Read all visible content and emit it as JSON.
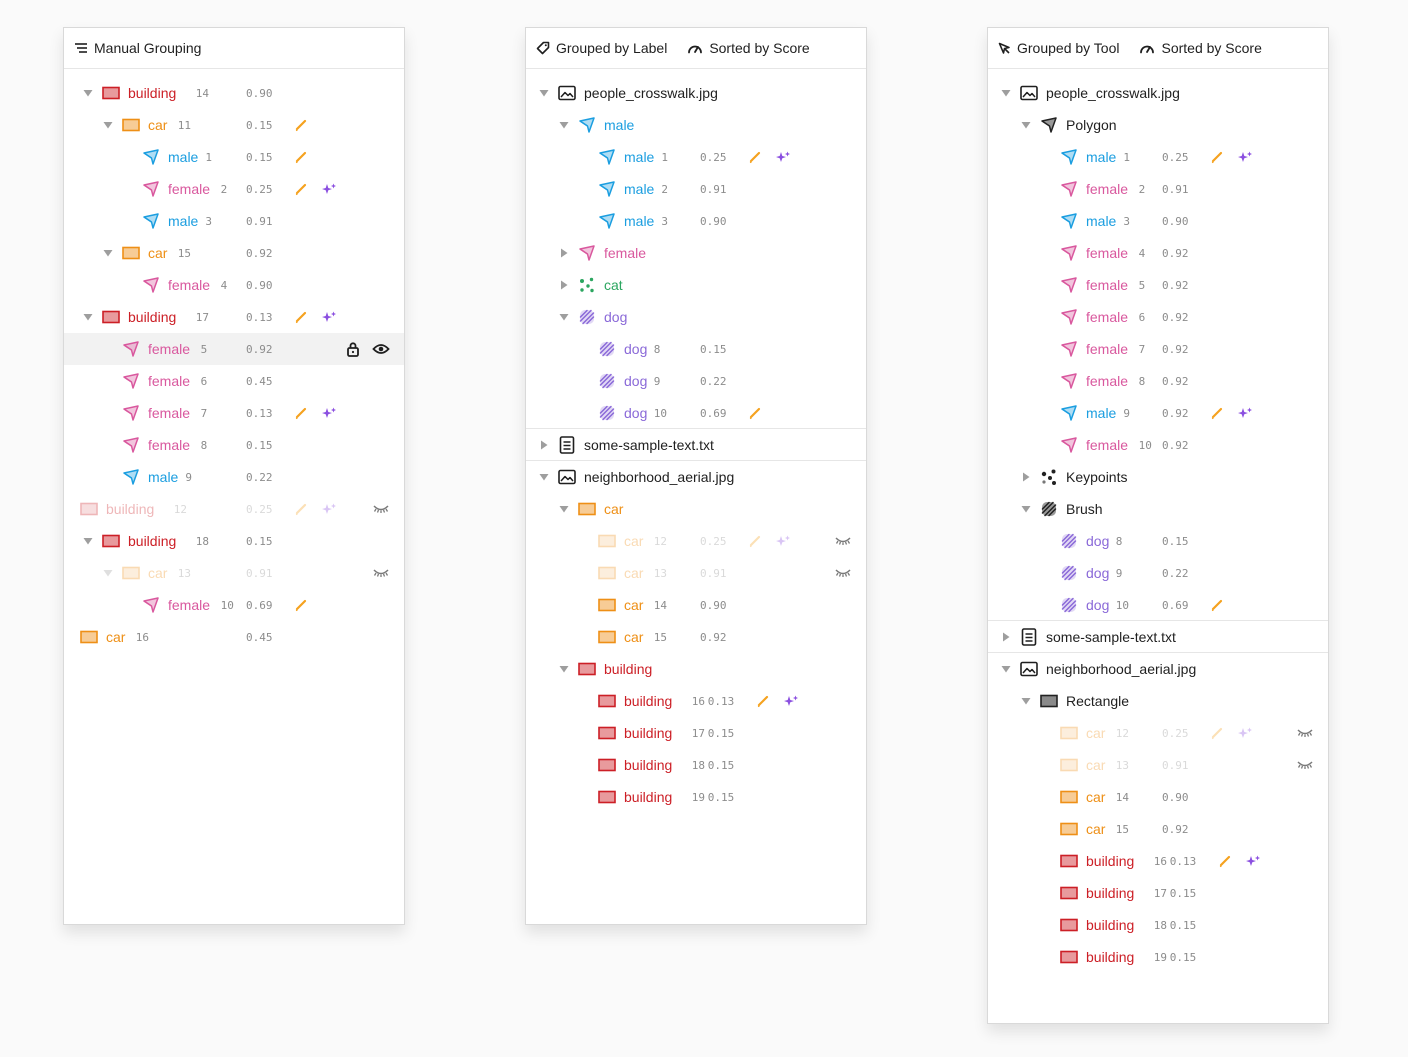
{
  "colors": {
    "building": "#cc1f26",
    "car": "#ee8f16",
    "male": "#1b9ee0",
    "female": "#d9589e",
    "dog": "#8a69d8",
    "cat": "#2ca660",
    "edit": "#f5a21f",
    "sparkle": "#8b4fe0"
  },
  "panels": [
    {
      "header": [
        {
          "icon": "list-icon",
          "label": "Manual Grouping"
        }
      ],
      "rows": [
        {
          "depth": 0,
          "caret": "down",
          "type": "ann",
          "cls": "building",
          "label": "building",
          "num": "14",
          "score": "0.90",
          "edit": false,
          "ai": false
        },
        {
          "depth": 1,
          "caret": "down",
          "type": "ann",
          "cls": "car",
          "label": "car",
          "num": "11",
          "score": "0.15",
          "edit": true,
          "ai": false
        },
        {
          "depth": 2,
          "caret": "",
          "type": "ann",
          "cls": "male",
          "label": "male",
          "num": "1",
          "score": "0.15",
          "edit": true,
          "ai": false
        },
        {
          "depth": 2,
          "caret": "",
          "type": "ann",
          "cls": "female",
          "label": "female",
          "num": "2",
          "score": "0.25",
          "edit": true,
          "ai": true
        },
        {
          "depth": 2,
          "caret": "",
          "type": "ann",
          "cls": "male",
          "label": "male",
          "num": "3",
          "score": "0.91",
          "edit": false,
          "ai": false
        },
        {
          "depth": 1,
          "caret": "down",
          "type": "ann",
          "cls": "car",
          "label": "car",
          "num": "15",
          "score": "0.92",
          "edit": false,
          "ai": false
        },
        {
          "depth": 2,
          "caret": "",
          "type": "ann",
          "cls": "female",
          "label": "female",
          "num": "4",
          "score": "0.90",
          "edit": false,
          "ai": false
        },
        {
          "depth": 0,
          "caret": "down",
          "type": "ann",
          "cls": "building",
          "label": "building",
          "num": "17",
          "score": "0.13",
          "edit": true,
          "ai": true
        },
        {
          "depth": 1,
          "caret": "",
          "type": "ann",
          "cls": "female",
          "label": "female",
          "num": "5",
          "score": "0.92",
          "edit": false,
          "ai": false,
          "selected": true,
          "lock": true,
          "eye": true
        },
        {
          "depth": 1,
          "caret": "",
          "type": "ann",
          "cls": "female",
          "label": "female",
          "num": "6",
          "score": "0.45",
          "edit": false,
          "ai": false
        },
        {
          "depth": 1,
          "caret": "",
          "type": "ann",
          "cls": "female",
          "label": "female",
          "num": "7",
          "score": "0.13",
          "edit": true,
          "ai": true
        },
        {
          "depth": 1,
          "caret": "",
          "type": "ann",
          "cls": "female",
          "label": "female",
          "num": "8",
          "score": "0.15",
          "edit": false,
          "ai": false
        },
        {
          "depth": 1,
          "caret": "",
          "type": "ann",
          "cls": "male",
          "label": "male",
          "num": "9",
          "score": "0.22",
          "edit": false,
          "ai": false
        },
        {
          "depth": -1,
          "caret": "",
          "type": "ann",
          "cls": "building",
          "label": "building",
          "num": "12",
          "score": "0.25",
          "edit": true,
          "ai": true,
          "hidden": true
        },
        {
          "depth": 0,
          "caret": "down",
          "type": "ann",
          "cls": "building",
          "label": "building",
          "num": "18",
          "score": "0.15",
          "edit": false,
          "ai": false
        },
        {
          "depth": 1,
          "caret": "down",
          "type": "ann",
          "cls": "car",
          "label": "car",
          "num": "13",
          "score": "0.91",
          "edit": false,
          "ai": false,
          "hidden": true
        },
        {
          "depth": 2,
          "caret": "",
          "type": "ann",
          "cls": "female",
          "label": "female",
          "num": "10",
          "score": "0.69",
          "edit": true,
          "ai": false
        },
        {
          "depth": -1,
          "caret": "",
          "type": "ann",
          "cls": "car",
          "label": "car",
          "num": "16",
          "score": "0.45",
          "edit": false,
          "ai": false
        }
      ]
    },
    {
      "header": [
        {
          "icon": "tag-icon",
          "label": "Grouped by Label"
        },
        {
          "icon": "gauge-icon",
          "label": "Sorted by Score"
        }
      ],
      "rows": [
        {
          "depth": 0,
          "caret": "down",
          "type": "file",
          "fileIcon": "image",
          "label": "people_crosswalk.jpg"
        },
        {
          "depth": 1,
          "caret": "down",
          "type": "group",
          "cls": "male",
          "label": "male"
        },
        {
          "depth": 2,
          "caret": "",
          "type": "ann",
          "cls": "male",
          "label": "male",
          "num": "1",
          "score": "0.25",
          "edit": true,
          "ai": true
        },
        {
          "depth": 2,
          "caret": "",
          "type": "ann",
          "cls": "male",
          "label": "male",
          "num": "2",
          "score": "0.91",
          "edit": false,
          "ai": false
        },
        {
          "depth": 2,
          "caret": "",
          "type": "ann",
          "cls": "male",
          "label": "male",
          "num": "3",
          "score": "0.90",
          "edit": false,
          "ai": false
        },
        {
          "depth": 1,
          "caret": "right",
          "type": "group",
          "cls": "female",
          "label": "female"
        },
        {
          "depth": 1,
          "caret": "right",
          "type": "group",
          "cls": "cat",
          "label": "cat"
        },
        {
          "depth": 1,
          "caret": "down",
          "type": "group",
          "cls": "dog",
          "label": "dog"
        },
        {
          "depth": 2,
          "caret": "",
          "type": "ann",
          "cls": "dog",
          "label": "dog",
          "num": "8",
          "score": "0.15",
          "edit": false,
          "ai": false
        },
        {
          "depth": 2,
          "caret": "",
          "type": "ann",
          "cls": "dog",
          "label": "dog",
          "num": "9",
          "score": "0.22",
          "edit": false,
          "ai": false
        },
        {
          "depth": 2,
          "caret": "",
          "type": "ann",
          "cls": "dog",
          "label": "dog",
          "num": "10",
          "score": "0.69",
          "edit": true,
          "ai": false
        },
        {
          "depth": 0,
          "caret": "right",
          "type": "file",
          "fileIcon": "text",
          "label": "some-sample-text.txt",
          "sep": true
        },
        {
          "depth": 0,
          "caret": "down",
          "type": "file",
          "fileIcon": "image",
          "label": "neighborhood_aerial.jpg",
          "sep": true
        },
        {
          "depth": 1,
          "caret": "down",
          "type": "group",
          "cls": "car",
          "label": "car"
        },
        {
          "depth": 2,
          "caret": "",
          "type": "ann",
          "cls": "car",
          "label": "car",
          "num": "12",
          "score": "0.25",
          "edit": true,
          "ai": true,
          "hidden": true
        },
        {
          "depth": 2,
          "caret": "",
          "type": "ann",
          "cls": "car",
          "label": "car",
          "num": "13",
          "score": "0.91",
          "edit": false,
          "ai": false,
          "hidden": true
        },
        {
          "depth": 2,
          "caret": "",
          "type": "ann",
          "cls": "car",
          "label": "car",
          "num": "14",
          "score": "0.90",
          "edit": false,
          "ai": false
        },
        {
          "depth": 2,
          "caret": "",
          "type": "ann",
          "cls": "car",
          "label": "car",
          "num": "15",
          "score": "0.92",
          "edit": false,
          "ai": false
        },
        {
          "depth": 1,
          "caret": "down",
          "type": "group",
          "cls": "building",
          "label": "building"
        },
        {
          "depth": 2,
          "caret": "",
          "type": "ann",
          "cls": "building",
          "label": "building",
          "num": "16",
          "score": "0.13",
          "edit": true,
          "ai": true
        },
        {
          "depth": 2,
          "caret": "",
          "type": "ann",
          "cls": "building",
          "label": "building",
          "num": "17",
          "score": "0.15",
          "edit": false,
          "ai": false
        },
        {
          "depth": 2,
          "caret": "",
          "type": "ann",
          "cls": "building",
          "label": "building",
          "num": "18",
          "score": "0.15",
          "edit": false,
          "ai": false
        },
        {
          "depth": 2,
          "caret": "",
          "type": "ann",
          "cls": "building",
          "label": "building",
          "num": "19",
          "score": "0.15",
          "edit": false,
          "ai": false
        }
      ]
    },
    {
      "header": [
        {
          "icon": "cursor-icon",
          "label": "Grouped by Tool"
        },
        {
          "icon": "gauge-icon",
          "label": "Sorted by Score"
        }
      ],
      "rows": [
        {
          "depth": 0,
          "caret": "down",
          "type": "file",
          "fileIcon": "image",
          "label": "people_crosswalk.jpg"
        },
        {
          "depth": 1,
          "caret": "down",
          "type": "tool",
          "tool": "polygon",
          "label": "Polygon"
        },
        {
          "depth": 2,
          "caret": "",
          "type": "ann",
          "cls": "male",
          "label": "male",
          "num": "1",
          "score": "0.25",
          "edit": true,
          "ai": true
        },
        {
          "depth": 2,
          "caret": "",
          "type": "ann",
          "cls": "female",
          "label": "female",
          "num": "2",
          "score": "0.91",
          "edit": false,
          "ai": false
        },
        {
          "depth": 2,
          "caret": "",
          "type": "ann",
          "cls": "male",
          "label": "male",
          "num": "3",
          "score": "0.90",
          "edit": false,
          "ai": false
        },
        {
          "depth": 2,
          "caret": "",
          "type": "ann",
          "cls": "female",
          "label": "female",
          "num": "4",
          "score": "0.92",
          "edit": false,
          "ai": false
        },
        {
          "depth": 2,
          "caret": "",
          "type": "ann",
          "cls": "female",
          "label": "female",
          "num": "5",
          "score": "0.92",
          "edit": false,
          "ai": false
        },
        {
          "depth": 2,
          "caret": "",
          "type": "ann",
          "cls": "female",
          "label": "female",
          "num": "6",
          "score": "0.92",
          "edit": false,
          "ai": false
        },
        {
          "depth": 2,
          "caret": "",
          "type": "ann",
          "cls": "female",
          "label": "female",
          "num": "7",
          "score": "0.92",
          "edit": false,
          "ai": false
        },
        {
          "depth": 2,
          "caret": "",
          "type": "ann",
          "cls": "female",
          "label": "female",
          "num": "8",
          "score": "0.92",
          "edit": false,
          "ai": false
        },
        {
          "depth": 2,
          "caret": "",
          "type": "ann",
          "cls": "male",
          "label": "male",
          "num": "9",
          "score": "0.92",
          "edit": true,
          "ai": true
        },
        {
          "depth": 2,
          "caret": "",
          "type": "ann",
          "cls": "female",
          "label": "female",
          "num": "10",
          "score": "0.92",
          "edit": false,
          "ai": false
        },
        {
          "depth": 1,
          "caret": "right",
          "type": "tool",
          "tool": "keypoints",
          "label": "Keypoints"
        },
        {
          "depth": 1,
          "caret": "down",
          "type": "tool",
          "tool": "brush",
          "label": "Brush"
        },
        {
          "depth": 2,
          "caret": "",
          "type": "ann",
          "cls": "dog",
          "label": "dog",
          "num": "8",
          "score": "0.15",
          "edit": false,
          "ai": false
        },
        {
          "depth": 2,
          "caret": "",
          "type": "ann",
          "cls": "dog",
          "label": "dog",
          "num": "9",
          "score": "0.22",
          "edit": false,
          "ai": false
        },
        {
          "depth": 2,
          "caret": "",
          "type": "ann",
          "cls": "dog",
          "label": "dog",
          "num": "10",
          "score": "0.69",
          "edit": true,
          "ai": false
        },
        {
          "depth": 0,
          "caret": "right",
          "type": "file",
          "fileIcon": "text",
          "label": "some-sample-text.txt",
          "sep": true
        },
        {
          "depth": 0,
          "caret": "down",
          "type": "file",
          "fileIcon": "image",
          "label": "neighborhood_aerial.jpg",
          "sep": true
        },
        {
          "depth": 1,
          "caret": "down",
          "type": "tool",
          "tool": "rectangle",
          "label": "Rectangle"
        },
        {
          "depth": 2,
          "caret": "",
          "type": "ann",
          "cls": "car",
          "label": "car",
          "num": "12",
          "score": "0.25",
          "edit": true,
          "ai": true,
          "hidden": true
        },
        {
          "depth": 2,
          "caret": "",
          "type": "ann",
          "cls": "car",
          "label": "car",
          "num": "13",
          "score": "0.91",
          "edit": false,
          "ai": false,
          "hidden": true
        },
        {
          "depth": 2,
          "caret": "",
          "type": "ann",
          "cls": "car",
          "label": "car",
          "num": "14",
          "score": "0.90",
          "edit": false,
          "ai": false
        },
        {
          "depth": 2,
          "caret": "",
          "type": "ann",
          "cls": "car",
          "label": "car",
          "num": "15",
          "score": "0.92",
          "edit": false,
          "ai": false
        },
        {
          "depth": 2,
          "caret": "",
          "type": "ann",
          "cls": "building",
          "label": "building",
          "num": "16",
          "score": "0.13",
          "edit": true,
          "ai": true
        },
        {
          "depth": 2,
          "caret": "",
          "type": "ann",
          "cls": "building",
          "label": "building",
          "num": "17",
          "score": "0.15",
          "edit": false,
          "ai": false
        },
        {
          "depth": 2,
          "caret": "",
          "type": "ann",
          "cls": "building",
          "label": "building",
          "num": "18",
          "score": "0.15",
          "edit": false,
          "ai": false
        },
        {
          "depth": 2,
          "caret": "",
          "type": "ann",
          "cls": "building",
          "label": "building",
          "num": "19",
          "score": "0.15",
          "edit": false,
          "ai": false
        }
      ]
    }
  ]
}
